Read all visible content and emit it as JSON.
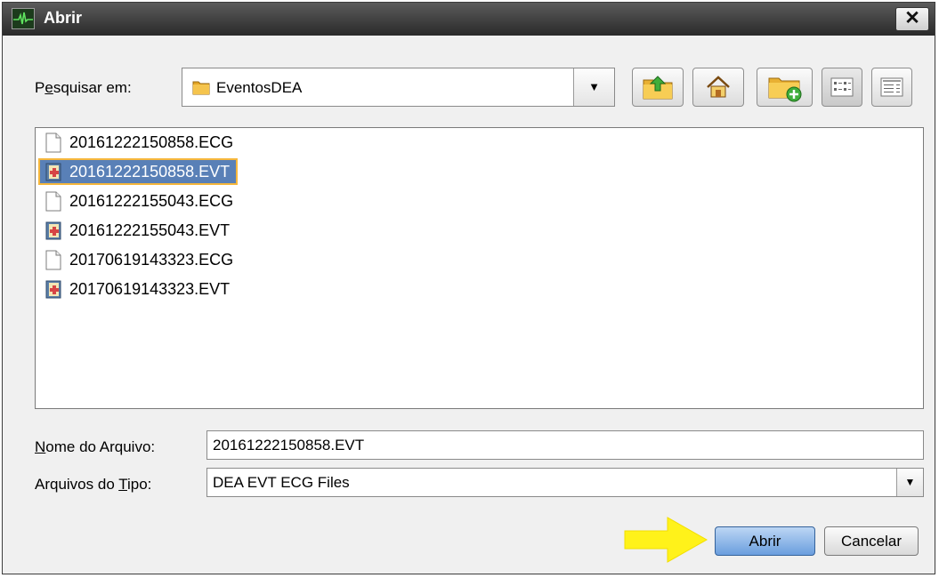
{
  "window": {
    "title": "Abrir"
  },
  "lookin": {
    "label_prefix": "P",
    "label_underlined": "e",
    "label_rest": "squisar em:",
    "value": "EventosDEA"
  },
  "toolbar_icons": [
    "folder-up-icon",
    "home-icon",
    "new-folder-icon",
    "list-view-icon",
    "details-view-icon"
  ],
  "files": [
    {
      "name": "20161222150858.ECG",
      "type": "ecg",
      "selected": false
    },
    {
      "name": "20161222150858.EVT",
      "type": "evt",
      "selected": true
    },
    {
      "name": "20161222155043.ECG",
      "type": "ecg",
      "selected": false
    },
    {
      "name": "20161222155043.EVT",
      "type": "evt",
      "selected": false
    },
    {
      "name": "20170619143323.ECG",
      "type": "ecg",
      "selected": false
    },
    {
      "name": "20170619143323.EVT",
      "type": "evt",
      "selected": false
    }
  ],
  "filename": {
    "label_underlined": "N",
    "label_rest": "ome do Arquivo:",
    "value": "20161222150858.EVT"
  },
  "filetype": {
    "label_prefix": "Arquivos do ",
    "label_underlined": "T",
    "label_rest": "ipo:",
    "value": "DEA EVT ECG Files"
  },
  "buttons": {
    "open": "Abrir",
    "cancel": "Cancelar"
  },
  "colors": {
    "selection": "#5980b7",
    "primary_button": "#6a9ede",
    "annotation_arrow": "#fff21a"
  }
}
